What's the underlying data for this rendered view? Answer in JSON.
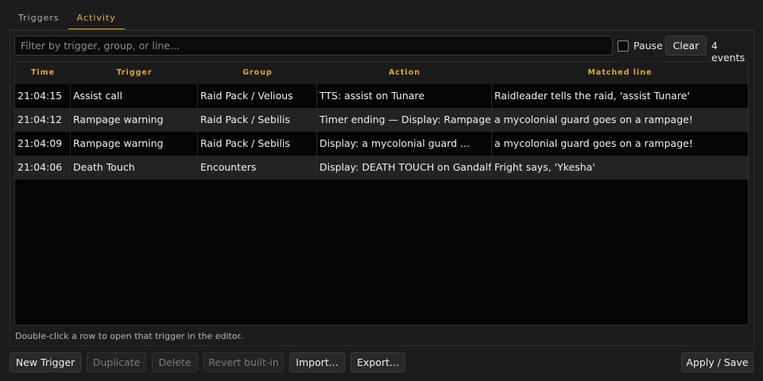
{
  "tabs": [
    {
      "label": "Triggers",
      "active": false
    },
    {
      "label": "Activity",
      "active": true
    }
  ],
  "filter": {
    "placeholder": "Filter by trigger, group, or line...",
    "value": ""
  },
  "pause": {
    "label": "Pause",
    "checked": false
  },
  "clear_label": "Clear",
  "event_count": "4 events",
  "table": {
    "columns": [
      "Time",
      "Trigger",
      "Group",
      "Action",
      "Matched line"
    ],
    "rows": [
      {
        "time": "21:04:15",
        "trigger": "Assist call",
        "group": "Raid Pack / Velious",
        "action": "TTS: assist on Tunare",
        "matched": "Raidleader tells the raid,  'assist Tunare'"
      },
      {
        "time": "21:04:12",
        "trigger": "Rampage warning",
        "group": "Raid Pack / Sebilis",
        "action": "Timer ending — Display: Rampage i...",
        "matched": "a mycolonial guard goes on a rampage!"
      },
      {
        "time": "21:04:09",
        "trigger": "Rampage warning",
        "group": "Raid Pack / Sebilis",
        "action": "Display: a mycolonial guard ...",
        "matched": "a mycolonial guard goes on a rampage!"
      },
      {
        "time": "21:04:06",
        "trigger": "Death Touch",
        "group": "Encounters",
        "action": "Display: DEATH TOUCH on Gandalf  ...",
        "matched": "Fright says, 'Ykesha'"
      }
    ]
  },
  "hint": "Double-click a row to open that trigger in the editor.",
  "buttons": {
    "new_trigger": "New Trigger",
    "duplicate": "Duplicate",
    "delete": "Delete",
    "revert": "Revert built-in",
    "import": "Import...",
    "export": "Export...",
    "apply": "Apply / Save"
  },
  "colors": {
    "accent": "#e2b43c",
    "background": "#1c1c1c",
    "table_background": "#050505"
  }
}
